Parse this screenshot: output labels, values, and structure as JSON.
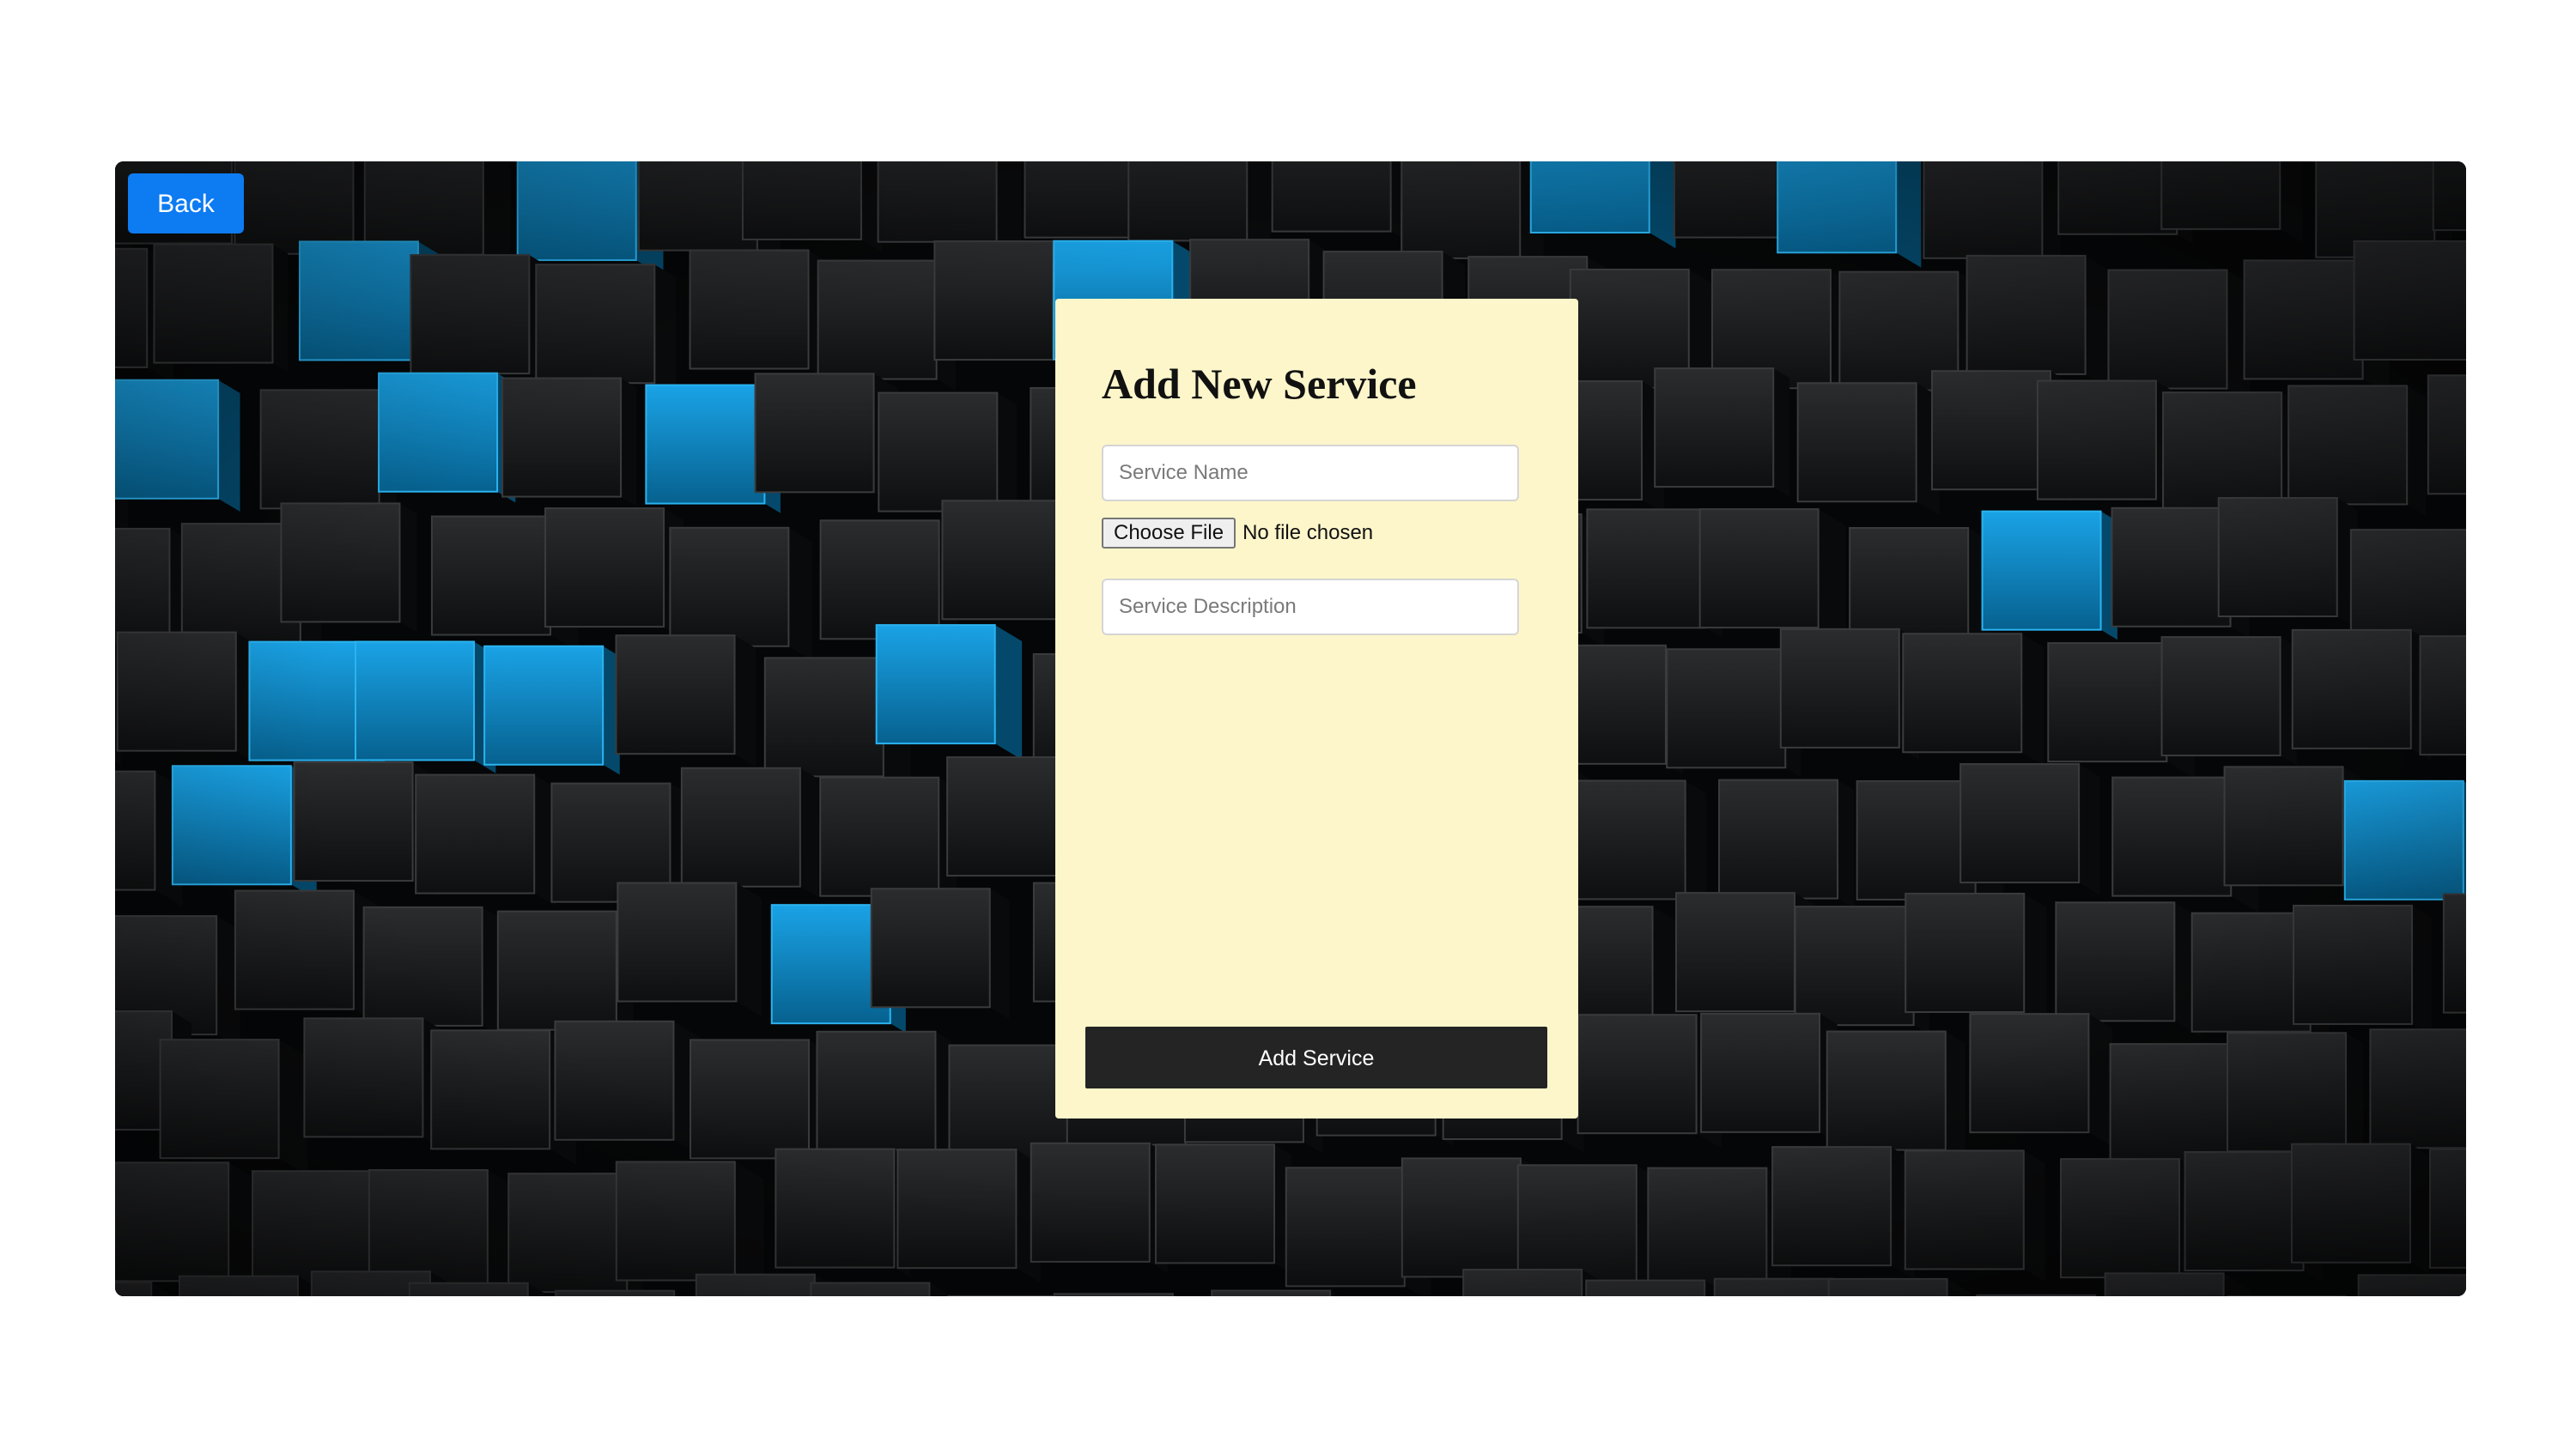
{
  "nav": {
    "back_label": "Back"
  },
  "form": {
    "title": "Add New Service",
    "service_name": {
      "value": "",
      "placeholder": "Service Name"
    },
    "file": {
      "button_label": "Choose File",
      "status": "No file chosen"
    },
    "service_description": {
      "value": "",
      "placeholder": "Service Description"
    },
    "submit_label": "Add Service"
  },
  "theme": {
    "page_background": "#ffffff",
    "card_background": "#fdf6ca",
    "back_button_color": "#0d7bf2",
    "submit_button_color": "#242424",
    "backdrop_dark": "#1e1f21",
    "backdrop_accent": "#0a86c8"
  }
}
